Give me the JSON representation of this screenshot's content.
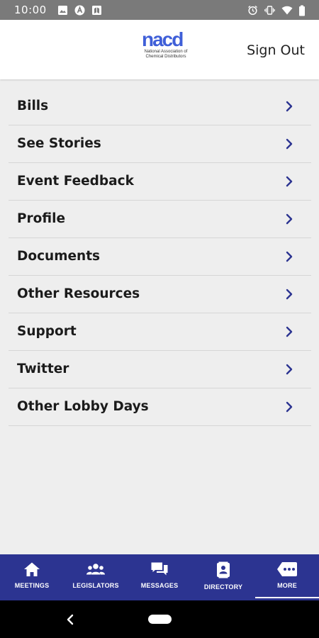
{
  "status_bar": {
    "time": "10:00",
    "icons": [
      "image-icon",
      "a-badge-icon",
      "map-icon",
      "alarm-icon",
      "vibrate-icon",
      "wifi-icon",
      "battery-icon"
    ]
  },
  "header": {
    "logo_text": "nacd",
    "logo_subtitle_line1": "National Association of",
    "logo_subtitle_line2": "Chemical Distributors",
    "sign_out_label": "Sign Out"
  },
  "menu": {
    "items": [
      {
        "label": "Bills"
      },
      {
        "label": "See Stories"
      },
      {
        "label": "Event Feedback"
      },
      {
        "label": "Profile"
      },
      {
        "label": "Documents"
      },
      {
        "label": "Other Resources"
      },
      {
        "label": "Support"
      },
      {
        "label": "Twitter"
      },
      {
        "label": "Other Lobby Days"
      }
    ],
    "chevron_icon": "chevron-right-icon",
    "chevron_color": "#2c3491"
  },
  "tab_bar": {
    "background": "#2c3491",
    "tabs": [
      {
        "label": "MEETINGS",
        "icon": "home-icon",
        "selected": false
      },
      {
        "label": "LEGISLATORS",
        "icon": "people-icon",
        "selected": false
      },
      {
        "label": "MESSAGES",
        "icon": "chat-bubbles-icon",
        "selected": false
      },
      {
        "label": "DIRECTORY",
        "icon": "contact-card-icon",
        "selected": false
      },
      {
        "label": "MORE",
        "icon": "more-dots-icon",
        "selected": true
      }
    ]
  },
  "nav_bar": {
    "back_icon": "back-chevron-icon",
    "home_icon": "home-pill-icon"
  }
}
